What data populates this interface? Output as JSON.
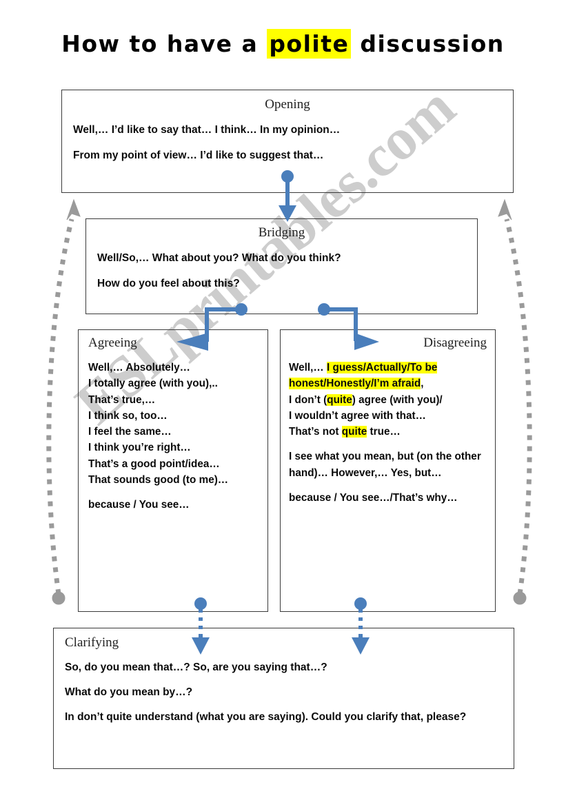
{
  "page": {
    "title_prefix": "How to have a ",
    "title_highlight": "polite",
    "title_suffix": " discussion",
    "watermark": "ESLprintables.com"
  },
  "colors": {
    "highlight": "#ffff00",
    "connector_blue": "#4a7ebb",
    "gray_arrow": "#9a9a9a",
    "box_border": "#3a3a3a",
    "text": "#0b0b0b"
  },
  "boxes": {
    "opening": {
      "title": "Opening",
      "lines": [
        "Well,…      I’d like to say that…  I think…  In my opinion…",
        "From my point of view…    I’d like to suggest that…"
      ]
    },
    "bridging": {
      "title": "Bridging",
      "lines": [
        "Well/So,…   What about you?  What do you think?",
        "How do you feel about this?"
      ]
    },
    "agreeing": {
      "title": "Agreeing",
      "lines": [
        "Well,…   Absolutely…",
        "I totally agree (with you),..",
        "That’s true,…",
        "I think so, too…",
        "I feel the same…",
        "I think you’re right…",
        "That’s a good point/idea…",
        "That sounds good (to me)…"
      ],
      "footer": "because / You see…"
    },
    "disagreeing": {
      "title": "Disagreeing",
      "group1": {
        "seg1_plain": "Well,…   ",
        "seg2_mark": "I guess/Actually/To be honest/Honestly/I’m afraid",
        "seg3_plain": ",",
        "line2_a": "I don’t (",
        "line2_mark": "quite",
        "line2_b": ") agree (with you)/",
        "line3": "I wouldn’t agree with that…",
        "line4_a": "That’s not ",
        "line4_mark": "quite",
        "line4_b": " true…"
      },
      "group2": "I see what you mean, but (on the other hand)… However,… Yes, but…",
      "footer": "because / You see…/That’s why…"
    },
    "clarifying": {
      "title": "Clarifying",
      "lines": [
        "So, do you mean that…?  So, are you saying that…?",
        "What do you mean by…?",
        "In don’t quite understand (what you are saying).  Could you clarify that, please?"
      ]
    }
  },
  "connectors": [
    {
      "name": "opening-to-bridging",
      "style": "solid-blue-down"
    },
    {
      "name": "bridging-to-agreeing",
      "style": "solid-blue-elbow-left"
    },
    {
      "name": "bridging-to-disagreeing",
      "style": "solid-blue-elbow-right"
    },
    {
      "name": "agreeing-to-clarifying",
      "style": "dotted-blue-down"
    },
    {
      "name": "disagreeing-to-clarifying",
      "style": "dotted-blue-down"
    },
    {
      "name": "left-loop-back",
      "style": "dotted-gray-curve-up"
    },
    {
      "name": "right-loop-back",
      "style": "dotted-gray-curve-up"
    }
  ]
}
